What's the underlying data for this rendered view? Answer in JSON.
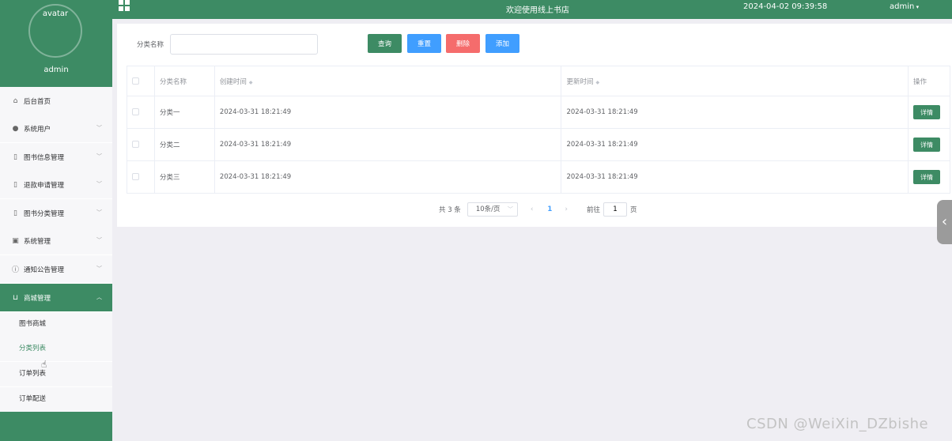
{
  "topbar": {
    "title": "欢迎使用线上书店",
    "datetime": "2024-04-02 09:39:58",
    "user": "admin"
  },
  "sidebar": {
    "avatar_alt": "avatar",
    "username": "admin",
    "items": [
      {
        "label": "后台首页",
        "icon": "home-icon",
        "has_children": false
      },
      {
        "label": "系统用户",
        "icon": "user-icon",
        "has_children": true
      },
      {
        "label": "图书信息管理",
        "icon": "document-icon",
        "has_children": true
      },
      {
        "label": "退款申请管理",
        "icon": "document-icon",
        "has_children": true
      },
      {
        "label": "图书分类管理",
        "icon": "document-icon",
        "has_children": true
      },
      {
        "label": "系统管理",
        "icon": "picture-icon",
        "has_children": true
      },
      {
        "label": "通知公告管理",
        "icon": "info-icon",
        "has_children": true
      },
      {
        "label": "商城管理",
        "icon": "cart-icon",
        "has_children": true,
        "expanded": true
      }
    ],
    "subitems": [
      {
        "label": "图书商城"
      },
      {
        "label": "分类列表",
        "current": true
      },
      {
        "label": "订单列表"
      },
      {
        "label": "订单配送"
      }
    ]
  },
  "search": {
    "label": "分类名称",
    "value": "",
    "placeholder": ""
  },
  "buttons": {
    "query": "查询",
    "reset": "重置",
    "delete": "删除",
    "add": "添加"
  },
  "table": {
    "headers": [
      "分类名称",
      "创建时间",
      "更新时间",
      "操作"
    ],
    "rows": [
      {
        "name": "分类一",
        "created": "2024-03-31 18:21:49",
        "updated": "2024-03-31 18:21:49",
        "action": "详情"
      },
      {
        "name": "分类二",
        "created": "2024-03-31 18:21:49",
        "updated": "2024-03-31 18:21:49",
        "action": "详情"
      },
      {
        "name": "分类三",
        "created": "2024-03-31 18:21:49",
        "updated": "2024-03-31 18:21:49",
        "action": "详情"
      }
    ]
  },
  "pagination": {
    "total_text": "共 3 条",
    "page_size": "10条/页",
    "current_page": "1",
    "goto_label": "前往",
    "goto_value": "1",
    "page_unit": "页"
  },
  "watermark": "CSDN @WeiXin_DZbishe",
  "colors": {
    "primary_green": "#3d8b64",
    "blue": "#409eff",
    "red": "#f56c6c"
  }
}
